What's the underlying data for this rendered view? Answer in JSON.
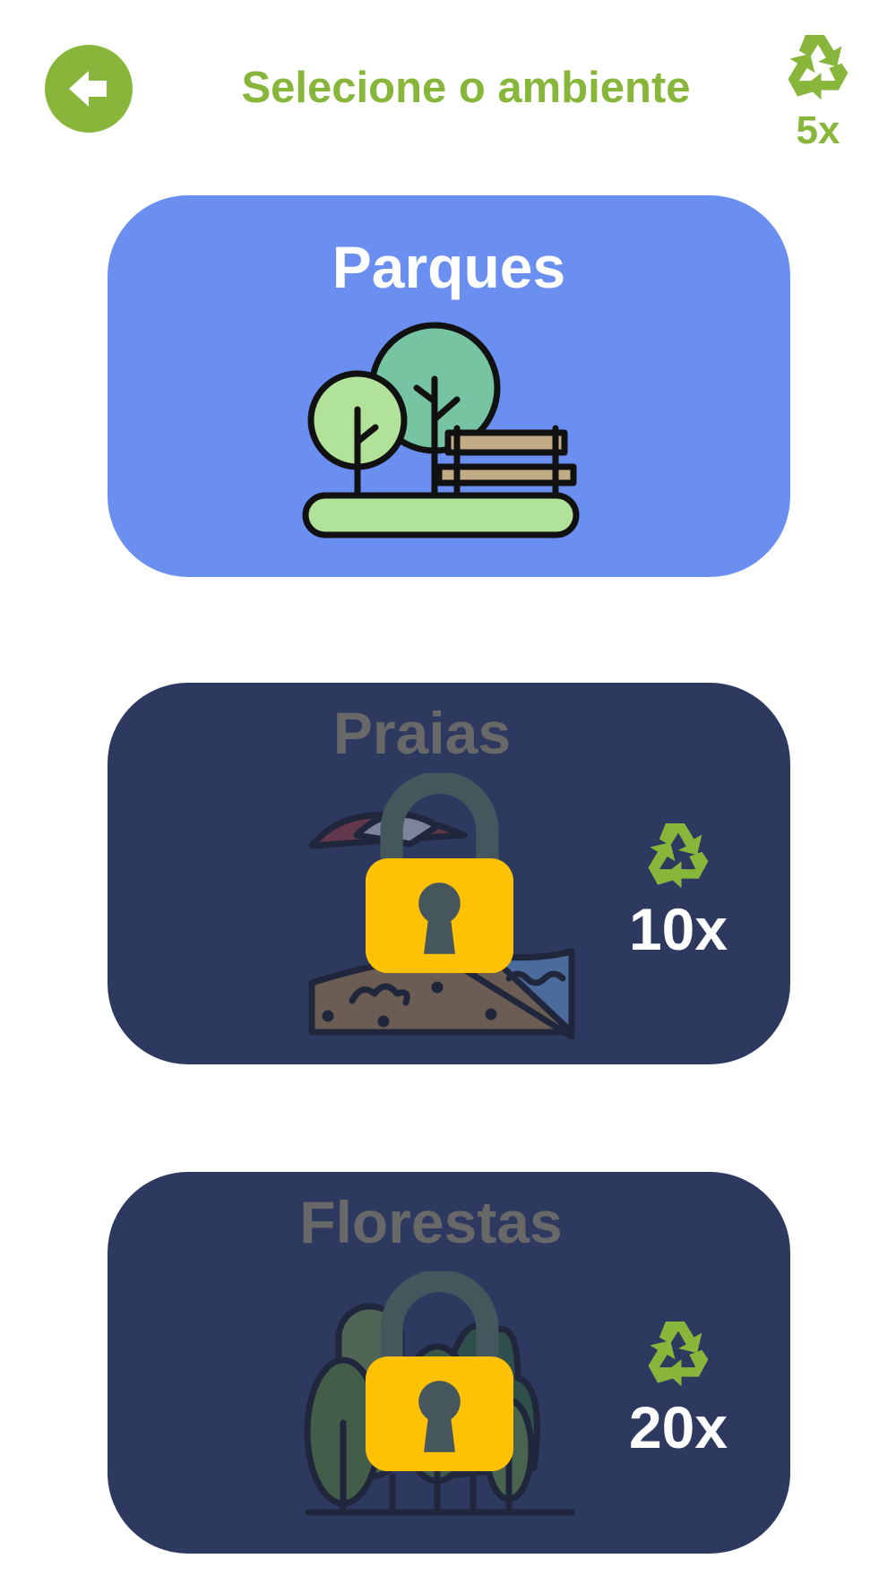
{
  "header": {
    "title": "Selecione o ambiente",
    "recycle_count": "5x"
  },
  "environments": [
    {
      "name": "Parques",
      "locked": false
    },
    {
      "name": "Praias",
      "locked": true,
      "cost": "10x"
    },
    {
      "name": "Florestas",
      "locked": true,
      "cost": "20x"
    }
  ],
  "icons": {
    "back": "back-arrow-icon",
    "currency": "recycle-icon",
    "lock": "padlock-icon"
  },
  "colors": {
    "accent_green": "#87b63b",
    "unlocked_card": "#6a8ff1",
    "locked_card": "#2e3960",
    "lock_yellow": "#fec104"
  }
}
